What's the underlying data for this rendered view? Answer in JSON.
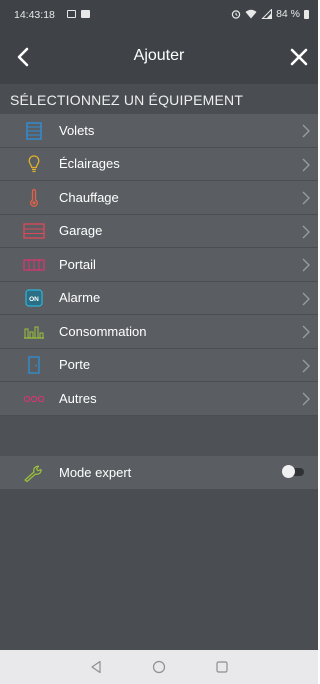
{
  "status_bar": {
    "time": "14:43:18",
    "battery": "84 %",
    "icons": [
      "message-icon",
      "image-icon",
      "alarm-icon",
      "wifi-icon",
      "signal-icon",
      "battery-icon"
    ]
  },
  "header": {
    "title": "Ajouter",
    "back_icon": "chevron-left-icon",
    "close_icon": "close-icon"
  },
  "section": {
    "title": "SÉLECTIONNEZ UN ÉQUIPEMENT"
  },
  "items": [
    {
      "label": "Volets",
      "icon": "shutter-icon",
      "color": "#2f8fd6"
    },
    {
      "label": "Éclairages",
      "icon": "bulb-icon",
      "color": "#e0b229"
    },
    {
      "label": "Chauffage",
      "icon": "thermometer-icon",
      "color": "#e0624a"
    },
    {
      "label": "Garage",
      "icon": "garage-icon",
      "color": "#e0485a"
    },
    {
      "label": "Portail",
      "icon": "gate-icon",
      "color": "#d8366f"
    },
    {
      "label": "Alarme",
      "icon": "alarm-on-icon",
      "color": "#2fb3d6"
    },
    {
      "label": "Consommation",
      "icon": "consumption-icon",
      "color": "#9cc23a"
    },
    {
      "label": "Porte",
      "icon": "door-icon",
      "color": "#2f8fd6"
    },
    {
      "label": "Autres",
      "icon": "others-icon",
      "color": "#d8366f"
    }
  ],
  "expert": {
    "label": "Mode expert",
    "icon": "wrench-icon",
    "icon_color": "#9cc23a",
    "enabled": false
  },
  "nav": {
    "icons": [
      "nav-back-icon",
      "nav-home-icon",
      "nav-recents-icon"
    ]
  },
  "colors": {
    "background": "#4a4e52",
    "header": "#3f4347",
    "list": "#5a5e62"
  }
}
